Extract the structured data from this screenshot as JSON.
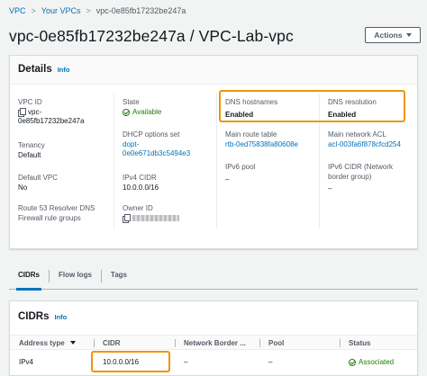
{
  "breadcrumb": {
    "items": [
      "VPC",
      "Your VPCs"
    ],
    "current": "vpc-0e85fb17232be247a"
  },
  "page_title": "vpc-0e85fb17232be247a / VPC-Lab-vpc",
  "actions_label": "Actions",
  "details": {
    "title": "Details",
    "info": "Info",
    "vpc_id": {
      "label": "VPC ID",
      "value_line1": "vpc-",
      "value_line2": "0e85fb17232be247a"
    },
    "tenancy": {
      "label": "Tenancy",
      "value": "Default"
    },
    "default_vpc": {
      "label": "Default VPC",
      "value": "No"
    },
    "route53": {
      "label_line1": "Route 53 Resolver DNS",
      "label_line2": "Firewall rule groups"
    },
    "state": {
      "label": "State",
      "value": "Available"
    },
    "dhcp": {
      "label": "DHCP options set",
      "value_line1": "dopt-",
      "value_line2": "0e0e671db3c5494e3"
    },
    "ipv4_cidr": {
      "label": "IPv4 CIDR",
      "value": "10.0.0.0/16"
    },
    "owner_id": {
      "label": "Owner ID"
    },
    "dns_hostnames": {
      "label": "DNS hostnames",
      "value": "Enabled"
    },
    "main_route_table": {
      "label": "Main route table",
      "value": "rtb-0ed75838fa80608e"
    },
    "ipv6_pool": {
      "label": "IPv6 pool",
      "value": "–"
    },
    "dns_resolution": {
      "label": "DNS resolution",
      "value": "Enabled"
    },
    "main_network_acl": {
      "label": "Main network ACL",
      "value": "acl-003fa6f878cfcd254"
    },
    "ipv6_cidr": {
      "label_line1": "IPv6 CIDR (Network",
      "label_line2": "border group)",
      "value": "–"
    }
  },
  "tabs": [
    "CIDRs",
    "Flow logs",
    "Tags"
  ],
  "cidrs": {
    "title": "CIDRs",
    "info": "Info",
    "columns": [
      "Address type",
      "CIDR",
      "Network Border ...",
      "Pool",
      "Status"
    ],
    "rows": [
      {
        "address_type": "IPv4",
        "cidr": "10.0.0.0/16",
        "network_border": "–",
        "pool": "–",
        "status": "Associated"
      }
    ]
  },
  "colors": {
    "accent": "#0073bb",
    "success": "#1d8102",
    "highlight": "#f0940a"
  }
}
